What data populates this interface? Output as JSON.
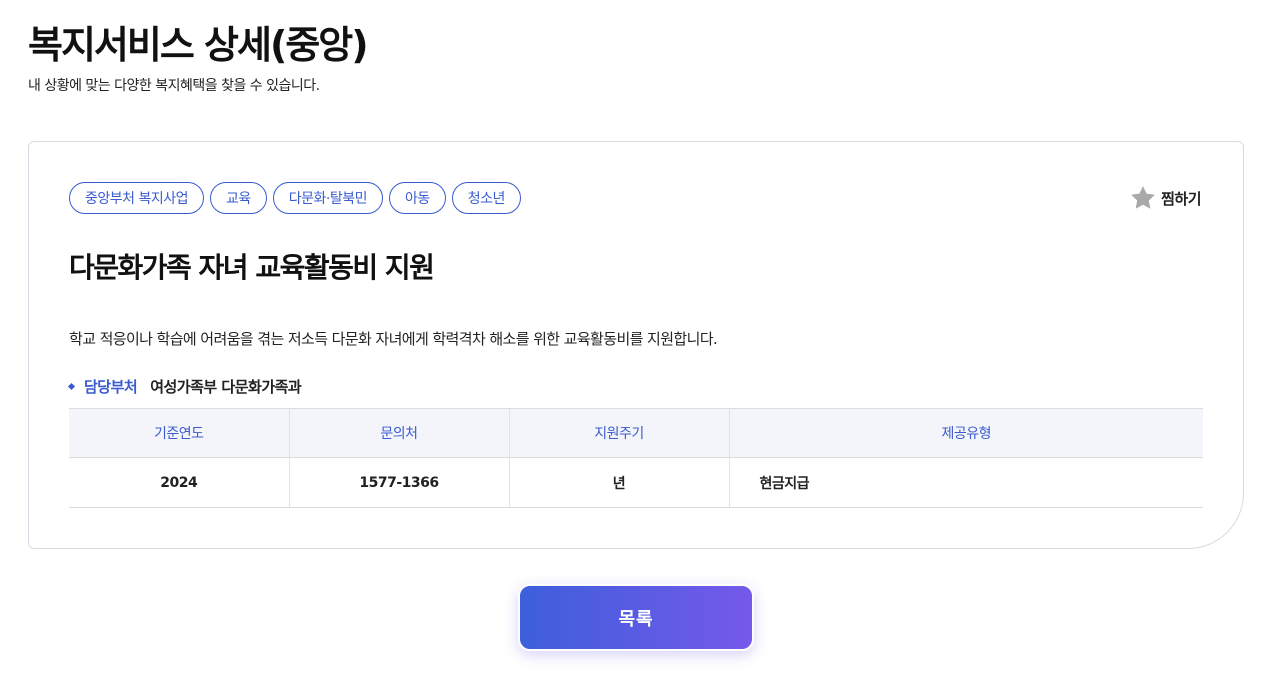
{
  "header": {
    "title": "복지서비스 상세(중앙)",
    "subtitle": "내 상황에 맞는 다양한 복지혜택을 찾을 수 있습니다."
  },
  "card": {
    "tags": [
      "중앙부처 복지사업",
      "교육",
      "다문화·탈북민",
      "아동",
      "청소년"
    ],
    "bookmark": {
      "label": "찜하기",
      "icon": "star-icon",
      "icon_color": "#a9a9a9"
    },
    "title": "다문화가족 자녀 교육활동비 지원",
    "description": "학교 적응이나 학습에 어려움을 겪는 저소득 다문화 자녀에게 학력격차 해소를 위한 교육활동비를 지원합니다.",
    "department": {
      "label": "담당부처",
      "value": "여성가족부 다문화가족과"
    },
    "table": {
      "headers": [
        "기준연도",
        "문의처",
        "지원주기",
        "제공유형"
      ],
      "row": [
        "2024",
        "1577-1366",
        "년",
        "현금지급"
      ]
    }
  },
  "footer": {
    "list_button": "목록"
  },
  "colors": {
    "accent": "#3a5bd0",
    "button_gradient_start": "#3d5fdb",
    "button_gradient_end": "#7559ea",
    "table_header_bg": "#f4f5fa"
  }
}
